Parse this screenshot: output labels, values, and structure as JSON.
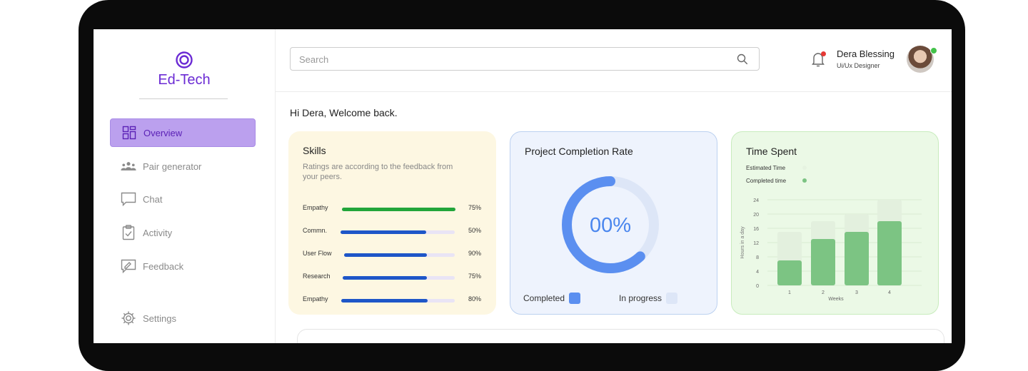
{
  "brand": {
    "name": "Ed-Tech",
    "color": "#6b2bd4"
  },
  "sidebar": {
    "items": [
      {
        "label": "Overview",
        "icon": "grid-icon",
        "active": true
      },
      {
        "label": "Pair generator",
        "icon": "people-icon",
        "active": false
      },
      {
        "label": "Chat",
        "icon": "chat-icon",
        "active": false
      },
      {
        "label": "Activity",
        "icon": "clipboard-check-icon",
        "active": false
      },
      {
        "label": "Feedback",
        "icon": "feedback-icon",
        "active": false
      }
    ],
    "settings": {
      "label": "Settings",
      "icon": "gear-icon"
    }
  },
  "search": {
    "placeholder": "Search"
  },
  "user": {
    "name": "Dera Blessing",
    "role": "Ui/Ux Designer"
  },
  "greeting": "Hi Dera, Welcome back.",
  "skills": {
    "title": "Skills",
    "subtitle": "Ratings are according to the feedback from your peers.",
    "rows": [
      {
        "label": "Empathy",
        "percent": "75%",
        "fill": 1.0,
        "color": "#22a53a"
      },
      {
        "label": "Commn.",
        "percent": "50%",
        "fill": 0.75,
        "color": "#1e56c8"
      },
      {
        "label": "User Flow",
        "percent": "90%",
        "fill": 0.75,
        "color": "#1e56c8"
      },
      {
        "label": "Research",
        "percent": "75%",
        "fill": 0.75,
        "color": "#1e56c8"
      },
      {
        "label": "Empathy",
        "percent": "80%",
        "fill": 0.76,
        "color": "#1e56c8"
      }
    ]
  },
  "project": {
    "title": "Project Completion Rate",
    "value": "00%",
    "progress": 0.62,
    "completed_label": "Completed",
    "in_progress_label": "In progress",
    "colors": {
      "completed": "#5b8ff0",
      "in_progress": "#dde6f7"
    }
  },
  "time_spent": {
    "title": "Time Spent",
    "legend": [
      {
        "label": "Estimated Time",
        "color": "#e6f3e1"
      },
      {
        "label": "Completed time",
        "color": "#7cc483"
      }
    ]
  },
  "chart_data": {
    "type": "bar",
    "categories": [
      "1",
      "2",
      "3",
      "4"
    ],
    "series": [
      {
        "name": "Estimated Time",
        "values": [
          15,
          18,
          20,
          24
        ]
      },
      {
        "name": "Completed time",
        "values": [
          7,
          13,
          15,
          18
        ]
      }
    ],
    "xlabel": "Weeks",
    "ylabel": "Hours in a day",
    "yticks": [
      "0",
      "4",
      "8",
      "12",
      "16",
      "20",
      "24"
    ],
    "ylim": [
      0,
      24
    ],
    "grid": true,
    "colors": {
      "estimated": "#e3f0de",
      "completed": "#7cc483"
    }
  }
}
